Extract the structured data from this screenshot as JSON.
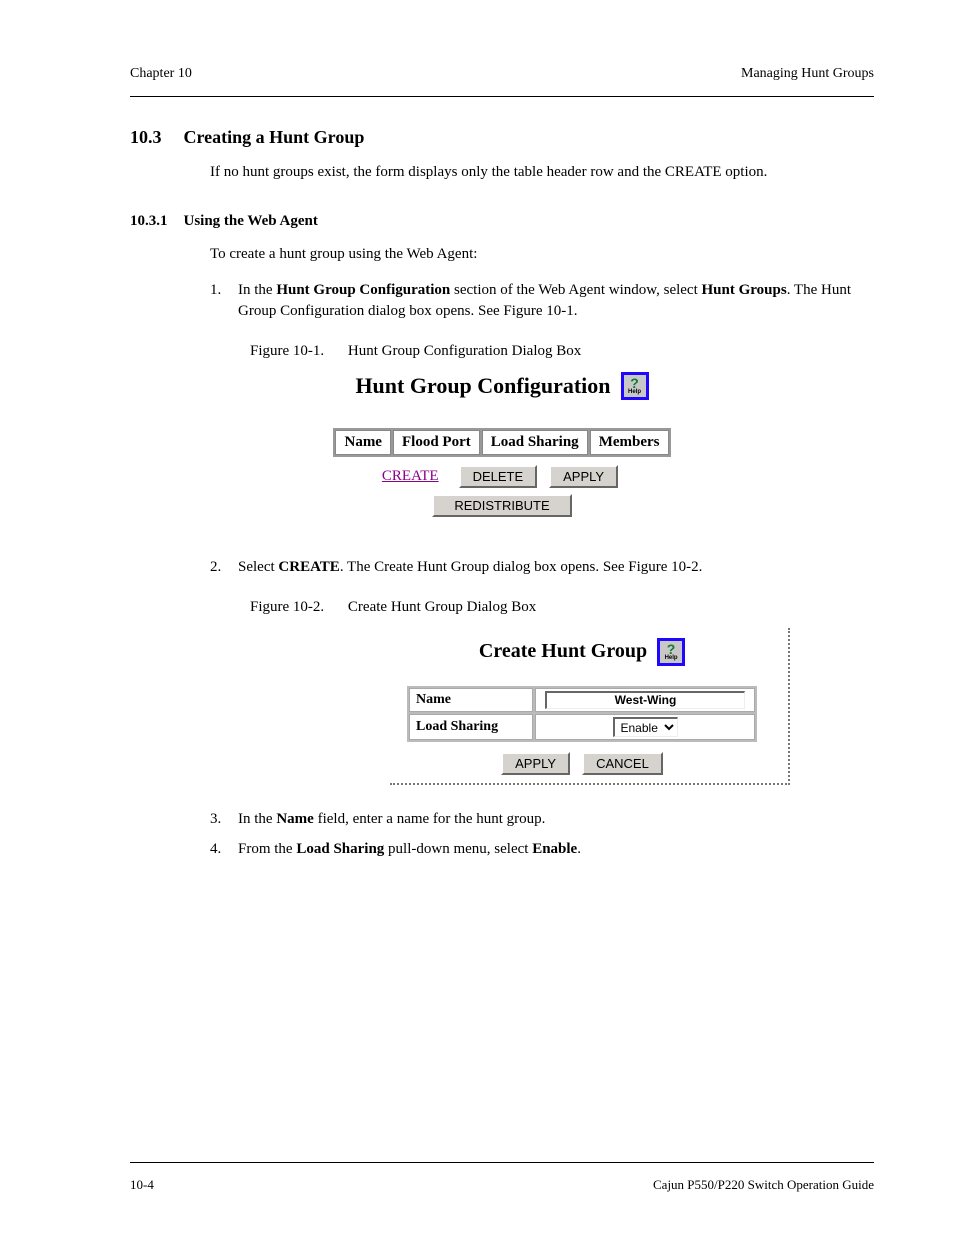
{
  "header": {
    "left": "Chapter 10",
    "right": "Managing Hunt Groups"
  },
  "section": {
    "number": "10.3",
    "title": "Creating a Hunt Group"
  },
  "intro": "If no hunt groups exist, the form displays only the table header row and the CREATE option.",
  "subsection": {
    "number": "10.3.1",
    "title": "Using the Web Agent"
  },
  "lead_in": "To create a hunt group using the Web Agent:",
  "steps": {
    "s1_a": "In the ",
    "s1_b": "Hunt Group Configuration",
    "s1_c": " section of the Web Agent window, select ",
    "s1_d": "Hunt Groups",
    "s1_e": ". The Hunt Group Configuration dialog box opens. See Figure 10-1.",
    "s2_a": "Select ",
    "s2_b": "CREATE",
    "s2_c": ". The Create Hunt Group dialog box opens. See ",
    "s2_d": "Figure 10-2.",
    "s3_a": "In the ",
    "s3_b": "Name",
    "s3_c": " field, enter a name for the hunt group.",
    "s4_a": "From the ",
    "s4_b": "Load Sharing",
    "s4_c": " pull-down menu, select ",
    "s4_d": "Enable",
    "s4_e": "."
  },
  "figure1": {
    "label": "Figure 10-1.",
    "caption": "Hunt Group Configuration Dialog Box"
  },
  "panel1": {
    "title": "Hunt Group Configuration",
    "cols": [
      "Name",
      "Flood Port",
      "Load Sharing",
      "Members"
    ],
    "create": "CREATE",
    "delete": "DELETE",
    "apply": "APPLY",
    "redistribute": "REDISTRIBUTE"
  },
  "figure2": {
    "label": "Figure 10-2.",
    "caption": "Create Hunt Group Dialog Box"
  },
  "panel2": {
    "title": "Create Hunt Group",
    "row1_label": "Name",
    "row1_value": "West-Wing",
    "row2_label": "Load Sharing",
    "row2_value": "Enable",
    "apply": "APPLY",
    "cancel": "CANCEL"
  },
  "footer": {
    "left": "10-4",
    "right": "Cajun P550/P220 Switch Operation Guide"
  }
}
